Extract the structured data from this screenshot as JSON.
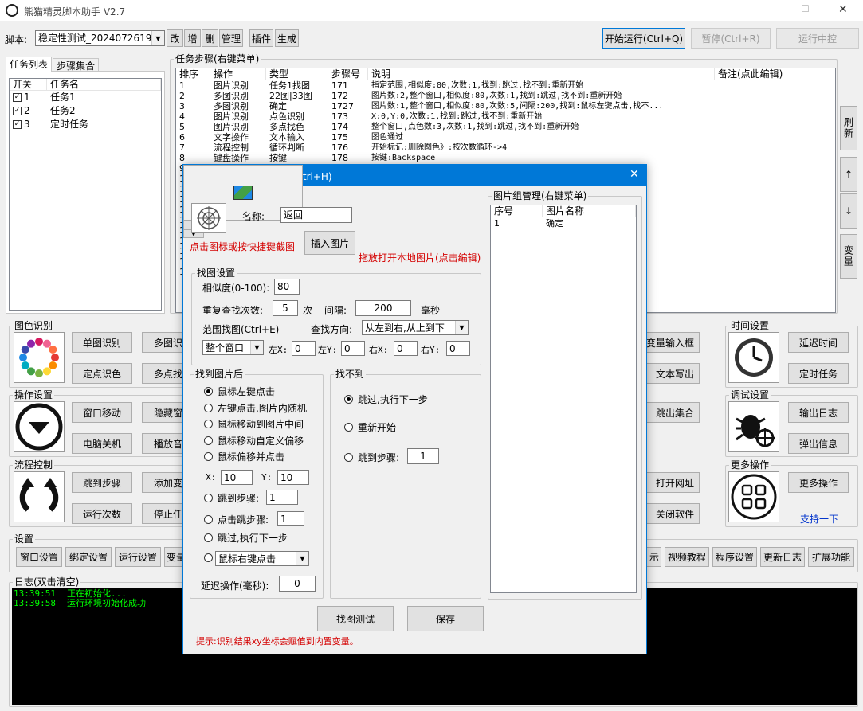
{
  "app": {
    "title": "熊猫精灵脚本助手",
    "version": "V2.7"
  },
  "window_controls": {
    "minimize": "—",
    "maximize": "☐",
    "close": "✕"
  },
  "toolbar": {
    "script_label": "脚本:",
    "script_value": "稳定性测试_2024072619191",
    "buttons": [
      "改",
      "增",
      "删",
      "管理",
      "插件",
      "生成"
    ],
    "start": "开始运行(Ctrl+Q)",
    "pause": "暂停(Ctrl+R)",
    "midstop": "运行中控"
  },
  "left_tabs": [
    "任务列表",
    "步骤集合"
  ],
  "task_list": {
    "headers": [
      "开关",
      "任务名"
    ],
    "rows": [
      {
        "id": "1",
        "name": "任务1"
      },
      {
        "id": "2",
        "name": "任务2"
      },
      {
        "id": "3",
        "name": "定时任务"
      }
    ]
  },
  "steps": {
    "title": "任务步骤(右键菜单)",
    "headers": [
      "排序",
      "操作",
      "类型",
      "步骤号",
      "说明",
      "备注(点此编辑)"
    ],
    "rows": [
      [
        "1",
        "图片识别",
        "任务1找图",
        "171",
        "指定范围,相似度:80,次数:1,找到:跳过,找不到:重新开始"
      ],
      [
        "2",
        "多图识别",
        "22图|33图",
        "172",
        "图片数:2,整个窗口,相似度:80,次数:1,找到:跳过,找不到:重新开始"
      ],
      [
        "3",
        "多图识别",
        "确定",
        "1727",
        "图片数:1,整个窗口,相似度:80,次数:5,间隔:200,找到:鼠标左键点击,找不..."
      ],
      [
        "4",
        "图片识别",
        "点色识别",
        "173",
        "X:0,Y:0,次数:1,找到:跳过,找不到:重新开始"
      ],
      [
        "5",
        "图片识别",
        "多点找色",
        "174",
        "整个窗口,点色数:3,次数:1,找到:跳过,找不到:重新开始"
      ],
      [
        "6",
        "文字操作",
        "文本输入",
        "175",
        "图色通过"
      ],
      [
        "7",
        "流程控制",
        "循环判断",
        "176",
        "开始标记:删除图色》:按次数循环->4"
      ],
      [
        "8",
        "键盘操作",
        "按键",
        "178",
        "按键:Backspace"
      ]
    ],
    "more_ids": [
      "9",
      "1",
      "1",
      "1",
      "1",
      "1",
      "1",
      "1",
      "1",
      "1",
      "1"
    ]
  },
  "side_buttons": {
    "refresh": "刷新",
    "up": "↑",
    "down": "↓",
    "vars": "变量"
  },
  "sections": {
    "color_recog": {
      "title": "图色识别",
      "buttons": [
        "单图识别",
        "多图识",
        "定点识色",
        "多点找"
      ]
    },
    "operation": {
      "title": "操作设置",
      "buttons": [
        "窗口移动",
        "隐藏窗",
        "电脑关机",
        "播放音"
      ]
    },
    "flow": {
      "title": "流程控制",
      "buttons": [
        "跳到步骤",
        "添加变",
        "运行次数",
        "停止任"
      ]
    },
    "settings": {
      "title": "设置",
      "buttons": [
        "窗口设置",
        "绑定设置",
        "运行设置",
        "变量",
        "示",
        "视频教程",
        "程序设置",
        "更新日志",
        "扩展功能"
      ]
    },
    "right_mid_buttons": [
      "变量输入框",
      "文本写出",
      "跳出集合",
      "打开网址",
      "关闭软件"
    ],
    "time": {
      "title": "时间设置",
      "buttons": [
        "延迟时间",
        "定时任务"
      ]
    },
    "debug": {
      "title": "调试设置",
      "buttons": [
        "输出日志",
        "弹出信息"
      ]
    },
    "more": {
      "title": "更多操作",
      "buttons": [
        "更多操作"
      ],
      "support": "支持一下"
    }
  },
  "log": {
    "title": "日志(双击清空)",
    "lines": [
      {
        "time": "13:39:51",
        "msg": "正在初始化..."
      },
      {
        "time": "13:39:58",
        "msg": "运行环境初始化成功"
      }
    ]
  },
  "dialog": {
    "title": "图片识别  截图快捷键(Ctrl+H)",
    "name_label": "名称:",
    "name_value": "返回",
    "capture_hint": "点击图标或按快捷键截图",
    "insert_btn": "插入图片",
    "drag_hint": "拖放打开本地图片(点击编辑)",
    "find": {
      "title": "找图设置",
      "similarity_label": "相似度(0-100):",
      "similarity": "80",
      "repeat_label": "重复查找次数:",
      "repeat": "5",
      "times_unit": "次",
      "interval_label": "间隔:",
      "interval": "200",
      "ms_unit": "毫秒",
      "range_label": "范围找图(Ctrl+E)",
      "direction_label": "查找方向:",
      "direction": "从左到右,从上到下",
      "window": "整个窗口",
      "coords": [
        {
          "label": "左X:",
          "value": "0"
        },
        {
          "label": "左Y:",
          "value": "0"
        },
        {
          "label": "右X:",
          "value": "0"
        },
        {
          "label": "右Y:",
          "value": "0"
        }
      ]
    },
    "found": {
      "title": "找到图片后",
      "options": [
        "鼠标左键点击",
        "左键点击,图片内随机",
        "鼠标移动到图片中间",
        "鼠标移动自定义偏移",
        "鼠标偏移并点击"
      ],
      "selected": 0,
      "x_label": "X:",
      "x": "10",
      "y_label": "Y:",
      "y": "10",
      "jump_label": "跳到步骤:",
      "jump": "1",
      "click_jump_label": "点击跳步骤:",
      "click_jump": "1",
      "skip_label": "跳过,执行下一步",
      "mouse_select": "鼠标右键点击",
      "delay_label": "延迟操作(毫秒):",
      "delay": "0"
    },
    "notfound": {
      "title": "找不到",
      "options": [
        "跳过,执行下一步",
        "重新开始"
      ],
      "jump_label": "跳到步骤:",
      "jump": "1"
    },
    "group_mgmt": {
      "title": "图片组管理(右键菜单)",
      "headers": [
        "序号",
        "图片名称"
      ],
      "rows": [
        {
          "id": "1",
          "name": "确定"
        }
      ]
    },
    "test_btn": "找图测试",
    "save_btn": "保存",
    "tip": "提示:识别结果xy坐标会赋值到内置变量。"
  },
  "colors": {
    "accent": "#0078d7",
    "log_bg": "#000000",
    "log_fg": "#00ff00",
    "red": "#d40000"
  }
}
